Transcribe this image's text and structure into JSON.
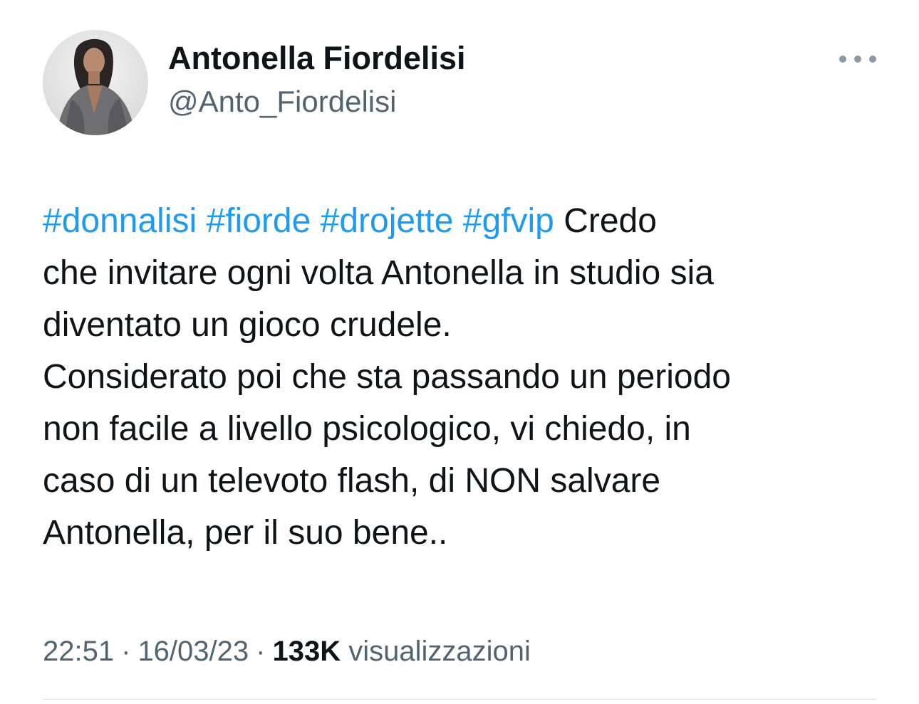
{
  "author": {
    "display_name": "Antonella Fiordelisi",
    "handle": "@Anto_Fiordelisi",
    "avatar_icon": "profile-photo"
  },
  "menu": {
    "icon": "more-horizontal-icon"
  },
  "tweet": {
    "hashtags": [
      "#donnalisi",
      "#fiorde",
      "#drojette",
      "#gfvip"
    ],
    "line1_rest": "Credo",
    "lines": [
      "che invitare ogni volta Antonella in studio sia",
      "diventato un gioco crudele.",
      "Considerato poi che sta passando un periodo",
      "non facile a livello psicologico, vi chiedo, in",
      "caso di un televoto flash, di NON salvare",
      "Antonella, per il suo bene.."
    ]
  },
  "meta": {
    "time": "22:51",
    "separator": "·",
    "date": "16/03/23",
    "views_count": "133K",
    "views_label": "visualizzazioni"
  },
  "colors": {
    "text": "#0f1419",
    "secondary": "#536471",
    "link": "#1d9bf0",
    "divider": "#dbdfe3"
  }
}
